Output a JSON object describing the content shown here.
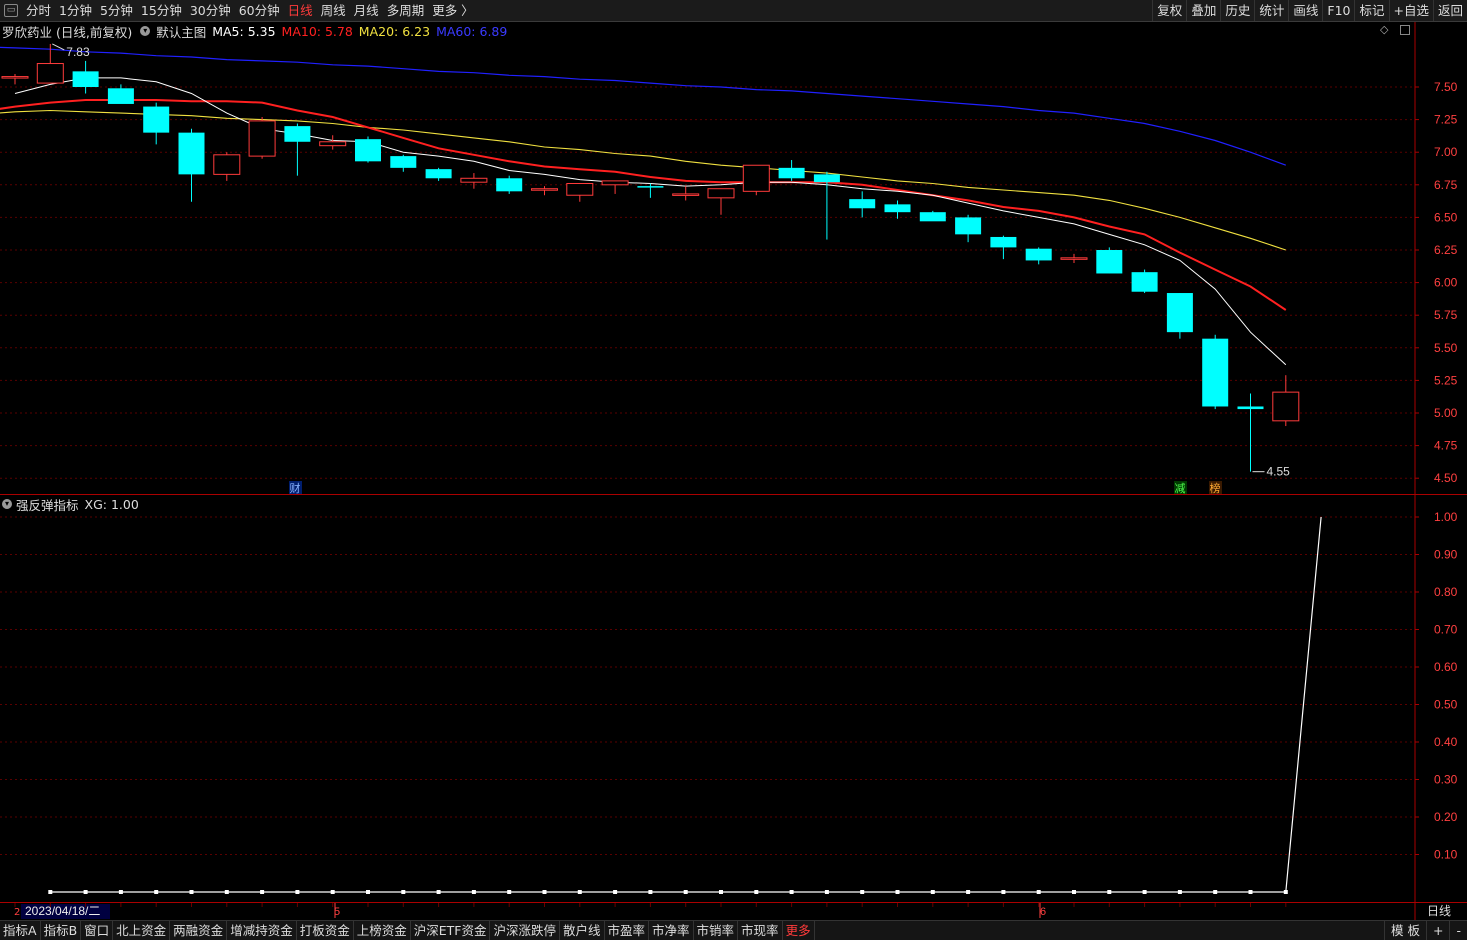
{
  "toolbar": {
    "tabs": [
      "分时",
      "1分钟",
      "5分钟",
      "15分钟",
      "30分钟",
      "60分钟",
      "日线",
      "周线",
      "月线",
      "多周期",
      "更多 〉"
    ],
    "active_tab": "日线",
    "right_buttons": [
      "复权",
      "叠加",
      "历史",
      "统计",
      "画线",
      "F10",
      "标记",
      "+自选",
      "返回"
    ]
  },
  "main_legend": {
    "stock": "罗欣药业 (日线,前复权)",
    "chart_name": "默认主图",
    "ma5": "MA5: 5.35",
    "ma10": "MA10: 5.78",
    "ma20": "MA20: 6.23",
    "ma60": "MA60: 6.89"
  },
  "sub_legend": {
    "indicator": "强反弹指标",
    "xg": "XG: 1.00"
  },
  "colors": {
    "up": "#ff3b3b",
    "down": "#00ffff",
    "ma5": "#ffffff",
    "ma10": "#ff2020",
    "ma20": "#f0e040",
    "ma60": "#2020ff",
    "axis": "#aa0000"
  },
  "bottom_tabs": [
    "指标A",
    "指标B",
    "窗口",
    "北上资金",
    "两融资金",
    "增减持资金",
    "打板资金",
    "上榜资金",
    "沪深ETF资金",
    "沪深涨跌停",
    "散户线",
    "市盈率",
    "市净率",
    "市销率",
    "市现率",
    "更多"
  ],
  "bottom_right": [
    "模 板",
    "+",
    "-"
  ],
  "markers": {
    "cai": "财",
    "jian": "减",
    "bang": "榜",
    "high_label": "7.83",
    "low_label": "4.55"
  },
  "date_axis": {
    "start": "2023/04/18/二",
    "m5": "5",
    "m6": "6",
    "period": "日线"
  },
  "chart_data": [
    {
      "type": "candlestick",
      "ylim": [
        4.45,
        7.95
      ],
      "yticks": [
        "7.50",
        "7.25",
        "7.00",
        "6.75",
        "6.50",
        "6.25",
        "6.00",
        "5.75",
        "5.50",
        "5.25",
        "5.00",
        "4.75",
        "4.50"
      ],
      "ohlc": [
        [
          7.58,
          7.6,
          7.52,
          7.58
        ],
        [
          7.53,
          7.83,
          7.53,
          7.68
        ],
        [
          7.62,
          7.7,
          7.45,
          7.5
        ],
        [
          7.49,
          7.52,
          7.38,
          7.37
        ],
        [
          7.35,
          7.38,
          7.06,
          7.15
        ],
        [
          7.15,
          7.18,
          6.62,
          6.83
        ],
        [
          6.83,
          7.0,
          6.78,
          6.98
        ],
        [
          6.97,
          7.27,
          6.95,
          7.24
        ],
        [
          7.2,
          7.22,
          6.82,
          7.08
        ],
        [
          7.05,
          7.13,
          7.02,
          7.08
        ],
        [
          7.1,
          7.12,
          6.92,
          6.93
        ],
        [
          6.97,
          6.98,
          6.85,
          6.88
        ],
        [
          6.87,
          6.88,
          6.78,
          6.8
        ],
        [
          6.77,
          6.84,
          6.72,
          6.8
        ],
        [
          6.8,
          6.82,
          6.68,
          6.7
        ],
        [
          6.72,
          6.74,
          6.67,
          6.72
        ],
        [
          6.67,
          6.76,
          6.62,
          6.76
        ],
        [
          6.75,
          6.78,
          6.68,
          6.78
        ],
        [
          6.74,
          6.76,
          6.65,
          6.73
        ],
        [
          6.68,
          6.74,
          6.63,
          6.68
        ],
        [
          6.65,
          6.72,
          6.52,
          6.72
        ],
        [
          6.7,
          6.9,
          6.67,
          6.9
        ],
        [
          6.88,
          6.94,
          6.78,
          6.8
        ],
        [
          6.83,
          6.85,
          6.33,
          6.77
        ],
        [
          6.64,
          6.7,
          6.5,
          6.57
        ],
        [
          6.6,
          6.63,
          6.49,
          6.54
        ],
        [
          6.54,
          6.55,
          6.48,
          6.47
        ],
        [
          6.5,
          6.52,
          6.31,
          6.37
        ],
        [
          6.35,
          6.36,
          6.18,
          6.27
        ],
        [
          6.26,
          6.27,
          6.14,
          6.17
        ],
        [
          6.19,
          6.22,
          6.15,
          6.19
        ],
        [
          6.25,
          6.27,
          6.07,
          6.07
        ],
        [
          6.08,
          6.1,
          5.92,
          5.93
        ],
        [
          5.92,
          5.92,
          5.57,
          5.62
        ],
        [
          5.57,
          5.6,
          5.03,
          5.05
        ],
        [
          5.05,
          5.15,
          4.55,
          5.03
        ],
        [
          4.94,
          5.29,
          4.9,
          5.16
        ]
      ],
      "ma5": [
        7.45,
        7.52,
        7.57,
        7.57,
        7.54,
        7.45,
        7.3,
        7.18,
        7.14,
        7.09,
        7.08,
        7.0,
        6.97,
        6.93,
        6.86,
        6.83,
        6.79,
        6.77,
        6.76,
        6.74,
        6.75,
        6.77,
        6.77,
        6.75,
        6.72,
        6.7,
        6.67,
        6.61,
        6.55,
        6.5,
        6.45,
        6.37,
        6.29,
        6.17,
        5.95,
        5.62,
        5.37
      ],
      "ma10": [
        7.31,
        7.35,
        7.38,
        7.4,
        7.4,
        7.4,
        7.39,
        7.39,
        7.38,
        7.32,
        7.27,
        7.19,
        7.11,
        7.03,
        6.98,
        6.93,
        6.89,
        6.87,
        6.85,
        6.81,
        6.78,
        6.77,
        6.77,
        6.77,
        6.77,
        6.75,
        6.71,
        6.67,
        6.63,
        6.58,
        6.55,
        6.5,
        6.43,
        6.37,
        6.23,
        6.1,
        5.97,
        5.79
      ],
      "ma20": [
        7.29,
        7.31,
        7.32,
        7.31,
        7.3,
        7.29,
        7.28,
        7.26,
        7.25,
        7.24,
        7.22,
        7.19,
        7.17,
        7.14,
        7.11,
        7.08,
        7.04,
        7.02,
        6.99,
        6.97,
        6.93,
        6.9,
        6.88,
        6.86,
        6.84,
        6.81,
        6.78,
        6.76,
        6.73,
        6.71,
        6.69,
        6.67,
        6.63,
        6.57,
        6.5,
        6.42,
        6.34,
        6.25
      ],
      "ma60": [
        7.81,
        7.8,
        7.79,
        7.77,
        7.76,
        7.74,
        7.73,
        7.71,
        7.7,
        7.69,
        7.67,
        7.66,
        7.64,
        7.62,
        7.61,
        7.59,
        7.58,
        7.56,
        7.55,
        7.53,
        7.51,
        7.5,
        7.48,
        7.47,
        7.45,
        7.43,
        7.41,
        7.39,
        7.37,
        7.35,
        7.32,
        7.3,
        7.26,
        7.22,
        7.16,
        7.09,
        7.0,
        6.9
      ]
    },
    {
      "type": "line",
      "name": "XG",
      "ylim": [
        0,
        1.0
      ],
      "yticks": [
        "1.00",
        "0.90",
        "0.80",
        "0.70",
        "0.60",
        "0.50",
        "0.40",
        "0.30",
        "0.20",
        "0.10"
      ],
      "values": [
        0,
        0,
        0,
        0,
        0,
        0,
        0,
        0,
        0,
        0,
        0,
        0,
        0,
        0,
        0,
        0,
        0,
        0,
        0,
        0,
        0,
        0,
        0,
        0,
        0,
        0,
        0,
        0,
        0,
        0,
        0,
        0,
        0,
        0,
        0,
        0,
        1
      ]
    }
  ]
}
